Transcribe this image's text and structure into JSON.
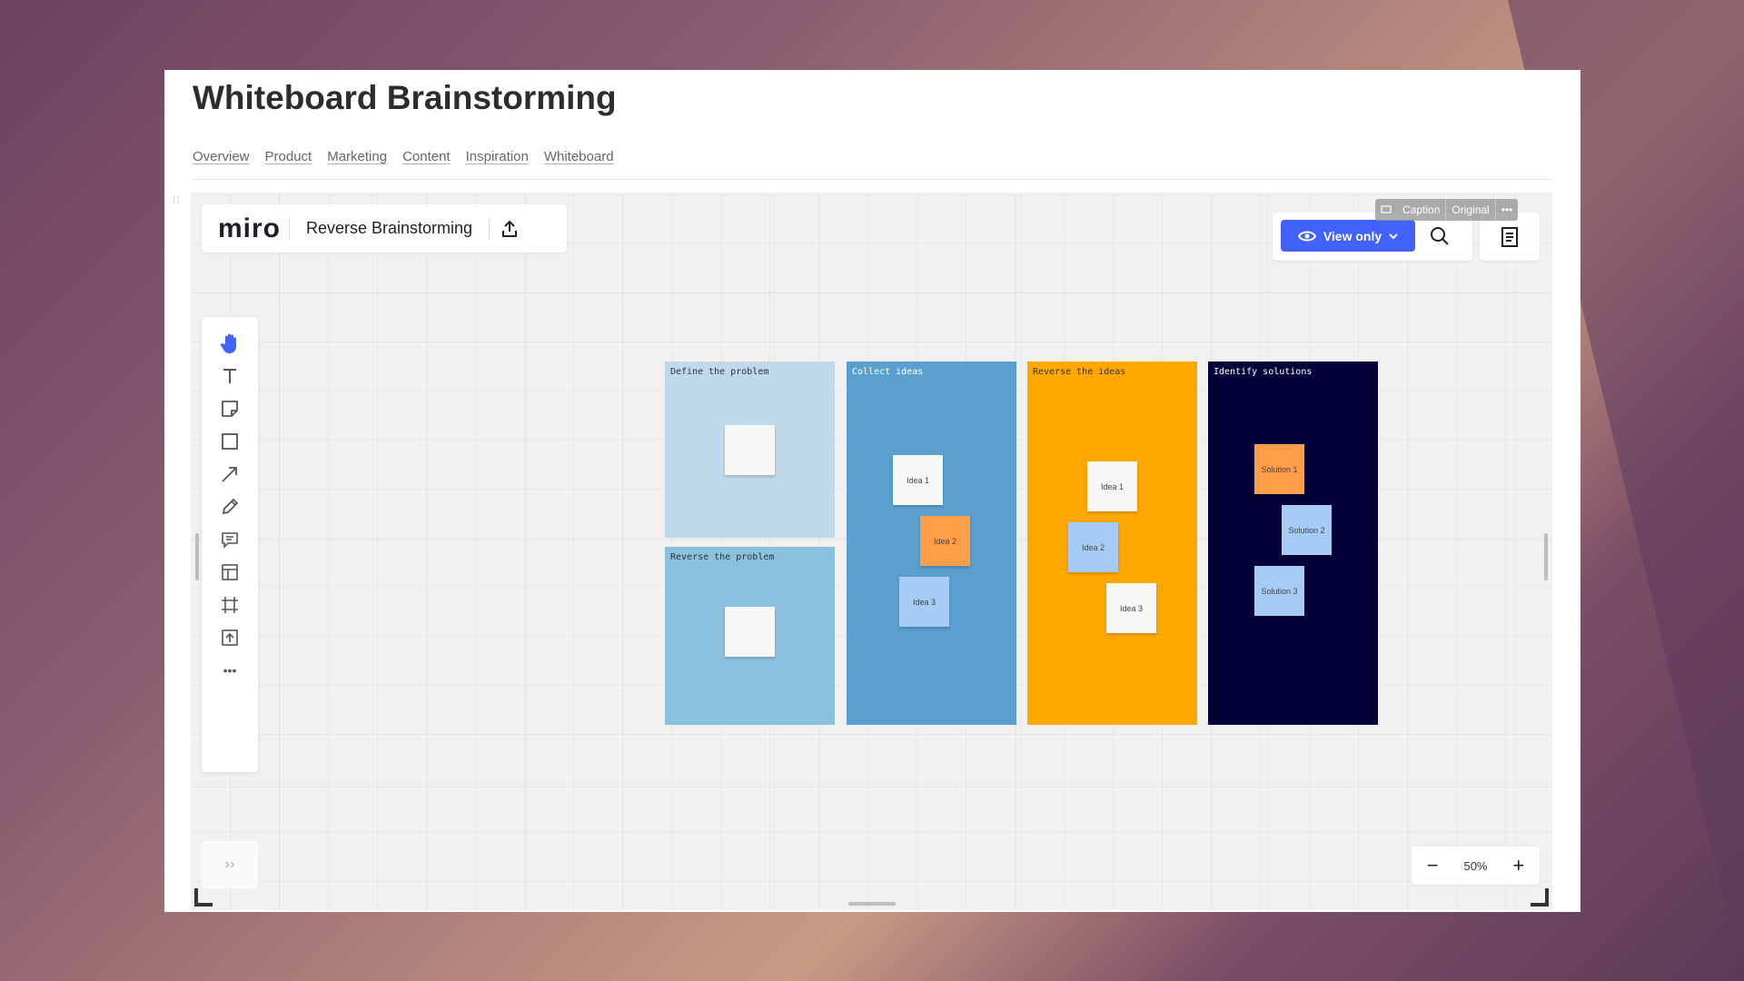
{
  "page": {
    "title": "Whiteboard Brainstorming",
    "tabs": [
      "Overview",
      "Product",
      "Marketing",
      "Content",
      "Inspiration",
      "Whiteboard"
    ]
  },
  "embed": {
    "overlay": {
      "caption": "Caption",
      "original": "Original",
      "more": "•••"
    }
  },
  "miro": {
    "logo": "miro",
    "board_name": "Reverse Brainstorming",
    "view_only_label": "View only",
    "zoom_level": "50%",
    "zoom_out": "−",
    "zoom_in": "+",
    "more_tools": "•••",
    "expand": "››",
    "tools": [
      "hand-icon",
      "text-icon",
      "sticky-note-icon",
      "shape-icon",
      "arrow-icon",
      "pen-icon",
      "comment-icon",
      "template-icon",
      "frame-icon",
      "upload-icon"
    ]
  },
  "frames": [
    {
      "label": "Define the problem",
      "color": "#bfd8ea",
      "label_color": "#333333"
    },
    {
      "label": "Reverse the problem",
      "color": "#8bc0df",
      "label_color": "#333333"
    },
    {
      "label": "Collect ideas",
      "color": "#5b9fcf",
      "label_color": "#ffffff"
    },
    {
      "label": "Reverse the ideas",
      "color": "#ffa800",
      "label_color": "#333333"
    },
    {
      "label": "Identify solutions",
      "color": "#050038",
      "label_color": "#ffffff"
    }
  ],
  "stickies": {
    "collect": [
      "Idea 1",
      "Idea 2",
      "Idea 3"
    ],
    "reverse": [
      "Idea 1",
      "Idea 2",
      "Idea 3"
    ],
    "solutions": [
      "Solution 1",
      "Solution 2",
      "Solution 3"
    ]
  },
  "colors": {
    "accent": "#4262ff",
    "sticky_white": "#f7f7f7",
    "sticky_orange": "#ff9d48",
    "sticky_blue": "#a6ccf5"
  }
}
